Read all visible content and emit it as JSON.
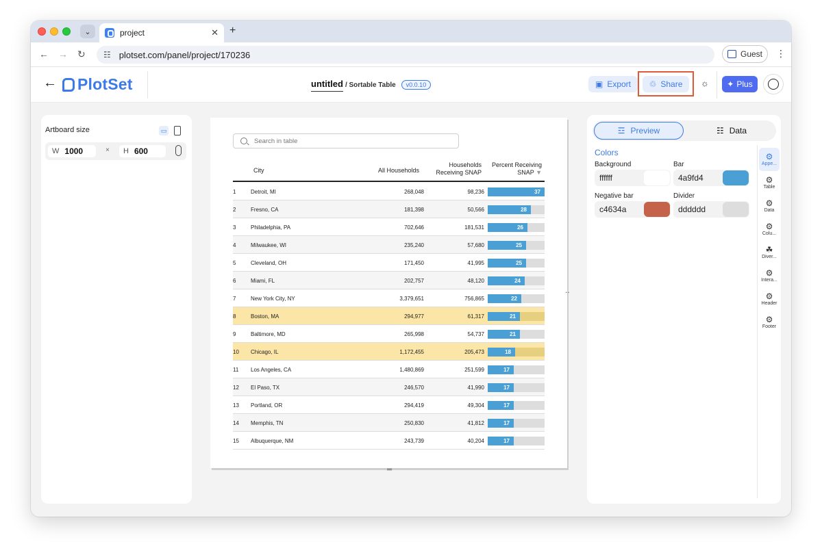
{
  "browser": {
    "tab_title": "project",
    "new_tab_label": "+",
    "url": "plotset.com/panel/project/170236",
    "guest_label": "Guest"
  },
  "app": {
    "logo_text": "PlotSet",
    "doc_title": "untitled",
    "doc_subtitle": "/ Sortable Table",
    "version": "v0.0.10",
    "export_label": "Export",
    "share_label": "Share",
    "plus_label": "Plus"
  },
  "left_panel": {
    "title": "Artboard size",
    "width_key": "W",
    "width_value": "1000",
    "times": "×",
    "height_key": "H",
    "height_value": "600"
  },
  "table": {
    "search_placeholder": "Search in table",
    "headers": {
      "city": "City",
      "all_households": "All Households",
      "hh_snap_1": "Households",
      "hh_snap_2": "Receiving SNAP",
      "pct_1": "Percent Receiving",
      "pct_2": "SNAP"
    },
    "rows": [
      {
        "rank": "1",
        "city": "Detroit, MI",
        "all": "268,048",
        "snap": "98,236",
        "pct": "37",
        "highlight": false
      },
      {
        "rank": "2",
        "city": "Fresno, CA",
        "all": "181,398",
        "snap": "50,566",
        "pct": "28",
        "highlight": false
      },
      {
        "rank": "3",
        "city": "Philadelphia, PA",
        "all": "702,646",
        "snap": "181,531",
        "pct": "26",
        "highlight": false
      },
      {
        "rank": "4",
        "city": "Milwaukee, WI",
        "all": "235,240",
        "snap": "57,680",
        "pct": "25",
        "highlight": false
      },
      {
        "rank": "5",
        "city": "Cleveland, OH",
        "all": "171,450",
        "snap": "41,995",
        "pct": "25",
        "highlight": false
      },
      {
        "rank": "6",
        "city": "Miami, FL",
        "all": "202,757",
        "snap": "48,120",
        "pct": "24",
        "highlight": false
      },
      {
        "rank": "7",
        "city": "New York City, NY",
        "all": "3,379,651",
        "snap": "756,865",
        "pct": "22",
        "highlight": false
      },
      {
        "rank": "8",
        "city": "Boston, MA",
        "all": "294,977",
        "snap": "61,317",
        "pct": "21",
        "highlight": true
      },
      {
        "rank": "9",
        "city": "Baltimore, MD",
        "all": "265,998",
        "snap": "54,737",
        "pct": "21",
        "highlight": false
      },
      {
        "rank": "10",
        "city": "Chicago, IL",
        "all": "1,172,455",
        "snap": "205,473",
        "pct": "18",
        "highlight": true
      },
      {
        "rank": "11",
        "city": "Los Angeles, CA",
        "all": "1,480,869",
        "snap": "251,599",
        "pct": "17",
        "highlight": false
      },
      {
        "rank": "12",
        "city": "El Paso, TX",
        "all": "246,570",
        "snap": "41,990",
        "pct": "17",
        "highlight": false
      },
      {
        "rank": "13",
        "city": "Portland, OR",
        "all": "294,419",
        "snap": "49,304",
        "pct": "17",
        "highlight": false
      },
      {
        "rank": "14",
        "city": "Memphis, TN",
        "all": "250,830",
        "snap": "41,812",
        "pct": "17",
        "highlight": false
      },
      {
        "rank": "15",
        "city": "Albuquerque, NM",
        "all": "243,739",
        "snap": "40,204",
        "pct": "17",
        "highlight": false
      }
    ]
  },
  "right_panel": {
    "preview_label": "Preview",
    "data_label": "Data",
    "colors_heading": "Colors",
    "background_label": "Background",
    "background_value": "ffffff",
    "bar_label": "Bar",
    "bar_value": "4a9fd4",
    "negative_label": "Negative bar",
    "negative_value": "c4634a",
    "divider_label": "Divider",
    "divider_value": "dddddd",
    "side_items": [
      "Appe...",
      "Table",
      "Data",
      "Colu...",
      "Diver...",
      "Intera...",
      "Header",
      "Footer"
    ]
  },
  "colors": {
    "accent": "#3b7ae8",
    "bar": "#4a9fd4",
    "negative_bar": "#c4634a",
    "divider": "#dddddd",
    "highlight_row": "#fbe5a7",
    "share_outline": "#e05a3a"
  }
}
